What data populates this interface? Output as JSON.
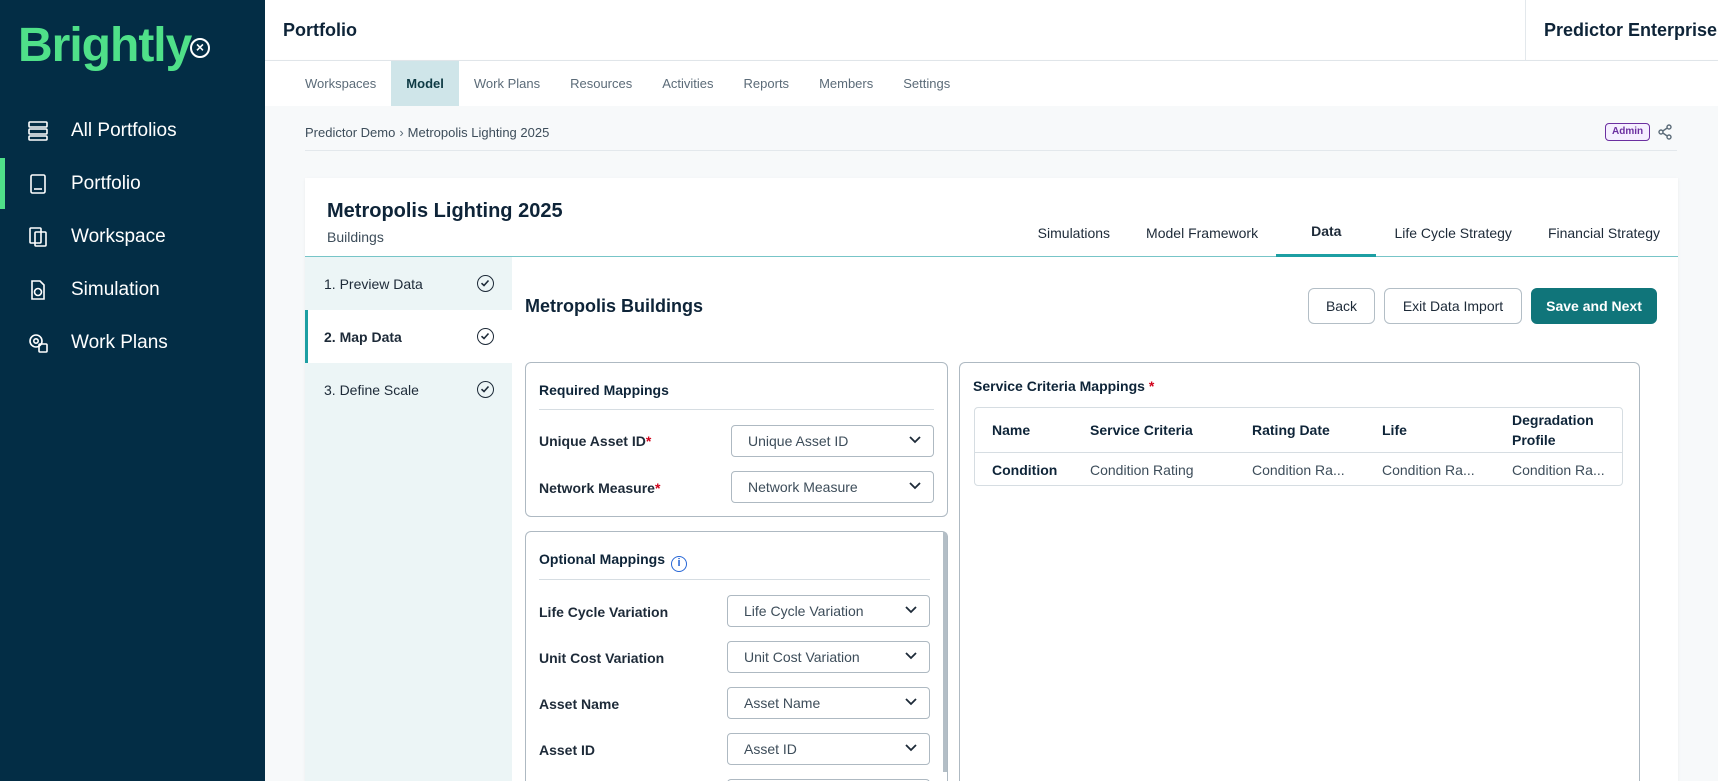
{
  "brand": {
    "logo_text": "Brightly"
  },
  "sidebar": {
    "items": [
      {
        "label": "All Portfolios",
        "icon": "database-icon"
      },
      {
        "label": "Portfolio",
        "icon": "book-icon",
        "active": true
      },
      {
        "label": "Workspace",
        "icon": "documents-icon"
      },
      {
        "label": "Simulation",
        "icon": "file-chart-icon"
      },
      {
        "label": "Work Plans",
        "icon": "gear-clipboard-icon"
      }
    ]
  },
  "header": {
    "title": "Portfolio",
    "product": "Predictor Enterprise"
  },
  "topnav": {
    "items": [
      "Workspaces",
      "Model",
      "Work Plans",
      "Resources",
      "Activities",
      "Reports",
      "Members",
      "Settings"
    ],
    "active": "Model"
  },
  "breadcrumb": {
    "parent": "Predictor Demo",
    "separator": "›",
    "current": "Metropolis Lighting 2025"
  },
  "badge": {
    "role": "Admin"
  },
  "card": {
    "title": "Metropolis Lighting 2025",
    "subtitle": "Buildings",
    "tabs": [
      "Simulations",
      "Model Framework",
      "Data",
      "Life Cycle Strategy",
      "Financial Strategy"
    ],
    "active_tab": "Data"
  },
  "steps": [
    {
      "label": "1. Preview Data"
    },
    {
      "label": "2. Map Data",
      "active": true
    },
    {
      "label": "3. Define Scale"
    }
  ],
  "section": {
    "title": "Metropolis Buildings",
    "back": "Back",
    "exit": "Exit Data Import",
    "save": "Save and Next"
  },
  "required": {
    "title": "Required Mappings",
    "fields": [
      {
        "label": "Unique Asset ID",
        "required_mark": "*",
        "value": "Unique Asset ID"
      },
      {
        "label": "Network Measure",
        "required_mark": "*",
        "value": "Network Measure"
      }
    ]
  },
  "optional": {
    "title": "Optional Mappings",
    "info_glyph": "i",
    "fields": [
      {
        "label": "Life Cycle Variation",
        "value": "Life Cycle Variation"
      },
      {
        "label": "Unit Cost Variation",
        "value": "Unit Cost Variation"
      },
      {
        "label": "Asset Name",
        "value": "Asset Name"
      },
      {
        "label": "Asset ID",
        "value": "Asset ID"
      }
    ]
  },
  "service": {
    "title": "Service Criteria Mappings",
    "required_mark": "*",
    "columns": [
      "Name",
      "Service Criteria",
      "Rating Date",
      "Life",
      "Degradation Profile"
    ],
    "rows": [
      [
        "Condition",
        "Condition Rating",
        "Condition Ra...",
        "Condition Ra...",
        "Condition Ra..."
      ]
    ]
  },
  "colors": {
    "sidebar": "#032d45",
    "brand_green": "#4fe089",
    "accent_teal": "#1d9fa3",
    "primary_button": "#10757a"
  }
}
